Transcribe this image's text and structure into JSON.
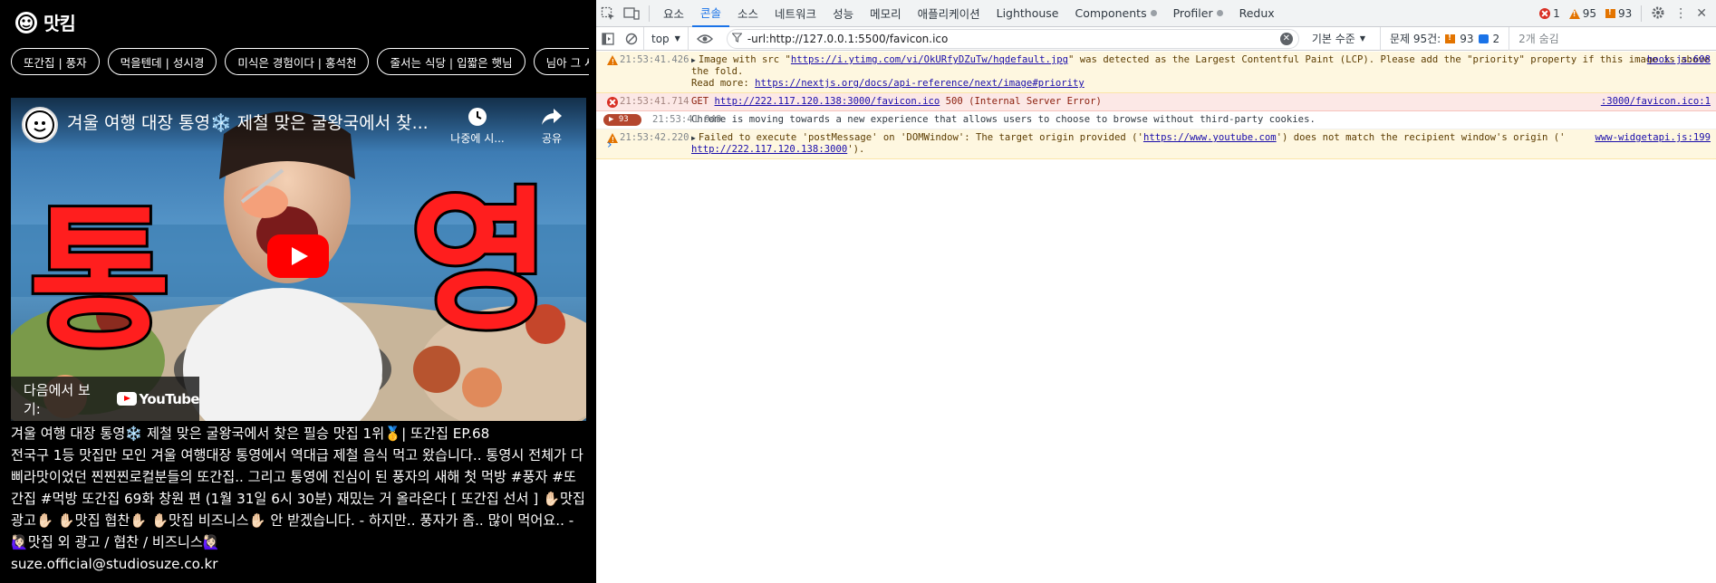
{
  "app": {
    "logo_text": "맛킴",
    "chips": [
      "또간집 | 풍자",
      "먹을텐데 | 성시경",
      "미식은 경험이다 | 홍석천",
      "줄서는 식당 | 입짧은 햇님",
      "님아 그 시장을 가"
    ],
    "video": {
      "title": "겨울 여행 대장 통영❄️ 제철 맞은 굴왕국에서 찾...",
      "later_label": "나중에 시...",
      "share_label": "공유",
      "thumb_text_left": "통",
      "thumb_text_right": "영",
      "watch_on_label": "다음에서 보기:",
      "youtube_label": "YouTube"
    },
    "description": [
      "겨울 여행 대장 통영❄️ 제철 맞은 굴왕국에서 찾은 필승 맛집 1위🥇| 또간집 EP.68",
      "전국구 1등 맛집만 모인 겨울 여행대장 통영에서 역대급 제철 음식 먹고 왔습니다.. 통영시 전체가 다 삐라맛이었던 찐찐찐로컬분들의 또간집.. 그리고 통영에 진심이 된 풍자의 새해 첫 먹방 #풍자 #또간집 #먹방 또간집 69화 창원 편 (1월 31일 6시 30분) 재밌는 거 올라온다 [ 또간집 선서 ] ✋🏻맛집 광고✋🏻 ✋🏻맛집 협찬✋🏻 ✋🏻맛집 비즈니스✋🏻 안 받겠습니다. - 하지만.. 풍자가 좀.. 많이 먹어요.. - 🙋🏻‍♀️맛집 외 광고 / 협찬 / 비즈니스🙋🏻‍♀️",
      "suze.official@studiosuze.co.kr"
    ]
  },
  "devtools": {
    "tabs": [
      "요소",
      "콘솔",
      "소스",
      "네트워크",
      "성능",
      "메모리",
      "애플리케이션",
      "Lighthouse",
      "Components",
      "Profiler",
      "Redux"
    ],
    "active_tab": "콘솔",
    "counts": {
      "errors": "1",
      "warnings": "95",
      "issues": "93"
    },
    "filter": {
      "context": "top",
      "value": "-url:http://127.0.0.1:5500/favicon.ico",
      "levels": "기본 수준",
      "issues_label": "문제 95건:",
      "issues_warn": "93",
      "issues_info": "2",
      "hidden": "2개 숨김"
    },
    "messages": [
      {
        "level": "warning",
        "time": "21:53:41.426",
        "pre": "Image with src \"",
        "link": "https://i.ytimg.com/vi/OkURfyDZuTw/hqdefault.jpg",
        "post": "\" was detected as the Largest Contentful Paint (LCP). Please add the \"priority\" property if this image is above the fold.",
        "line2_pre": "Read more: ",
        "line2_link": "https://nextjs.org/docs/api-reference/next/image#priority",
        "source": "hook.js:608"
      },
      {
        "level": "error",
        "time": "21:53:41.714",
        "pre": "GET ",
        "link": "http://222.117.120.138:3000/favicon.ico",
        "post": " 500 (Internal Server Error)",
        "source": ":3000/favicon.ico:1"
      },
      {
        "level": "info",
        "badge": "93",
        "time": "21:53:41.949",
        "text": "Chrome is moving towards a new experience that allows users to choose to browse without third-party cookies."
      },
      {
        "level": "warning",
        "time": "21:53:42.220",
        "pre": "Failed to execute 'postMessage' on 'DOMWindow': The target origin provided ('",
        "link": "https://www.youtube.com",
        "post": "') does not match the recipient window's origin ('",
        "line2_link": "http://222.117.120.138:3000",
        "line2_post": "').",
        "source": "www-widgetapi.js:199"
      }
    ]
  }
}
